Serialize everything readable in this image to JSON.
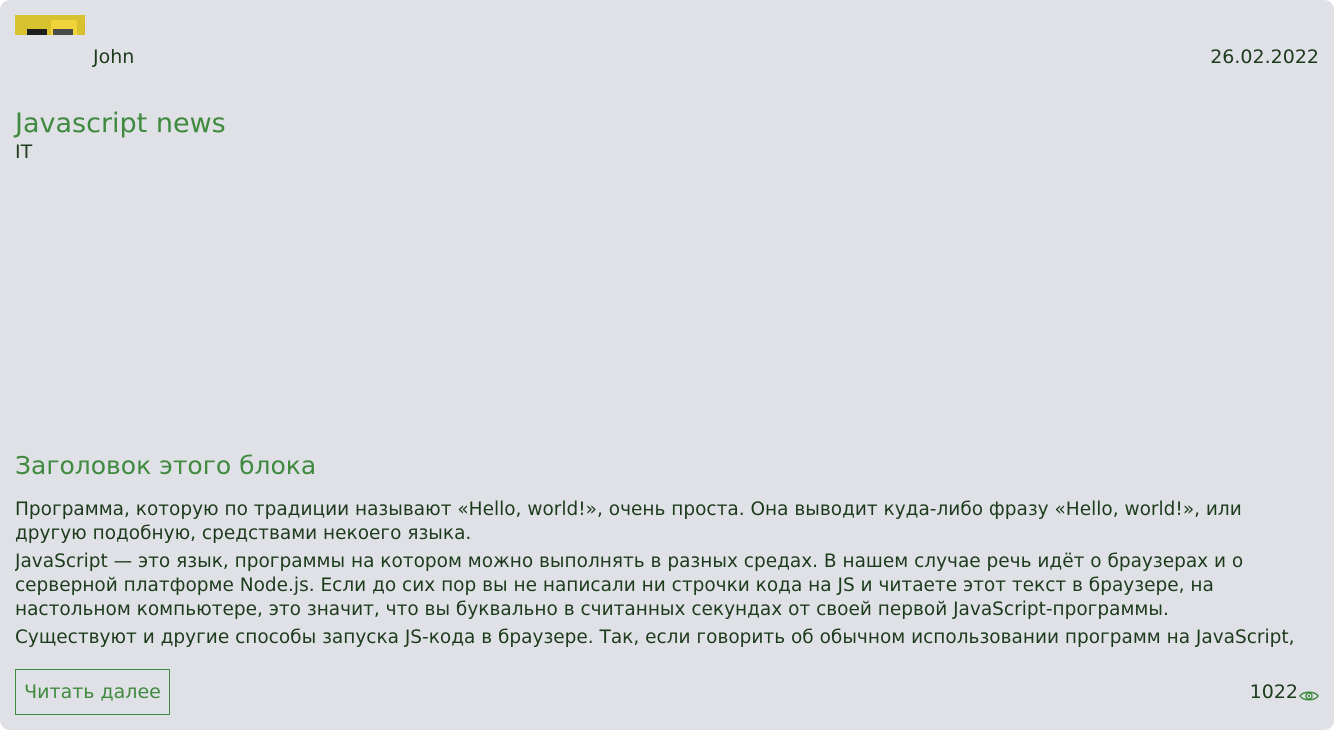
{
  "post": {
    "author": "John",
    "date": "26.02.2022",
    "title": "Javascript news",
    "category": "IT",
    "block_heading": "Заголовок этого блока",
    "paragraphs": [
      "Программа, которую по традиции называют «Hello, world!», очень проста. Она выводит куда-либо фразу «Hello, world!», или другую подобную, средствами некоего языка.",
      "JavaScript — это язык, программы на котором можно выполнять в разных средах. В нашем случае речь идёт о браузерах и о серверной платформе Node.js. Если до сих пор вы не написали ни строчки кода на JS и читаете этот текст в браузере, на настольном компьютере, это значит, что вы буквально в считанных секундах от своей первой JavaScript-программы.",
      "Существуют и другие способы запуска JS-кода в браузере. Так, если говорить об обычном использовании программ на JavaScript, они"
    ],
    "read_more_label": "Читать далее",
    "views": "1022",
    "views_icon": "eye-icon"
  },
  "colors": {
    "background": "#e0e1e6",
    "accent": "#3f8a3f",
    "text": "#1c3a1c",
    "avatar_yellow": "#d8c02a"
  }
}
